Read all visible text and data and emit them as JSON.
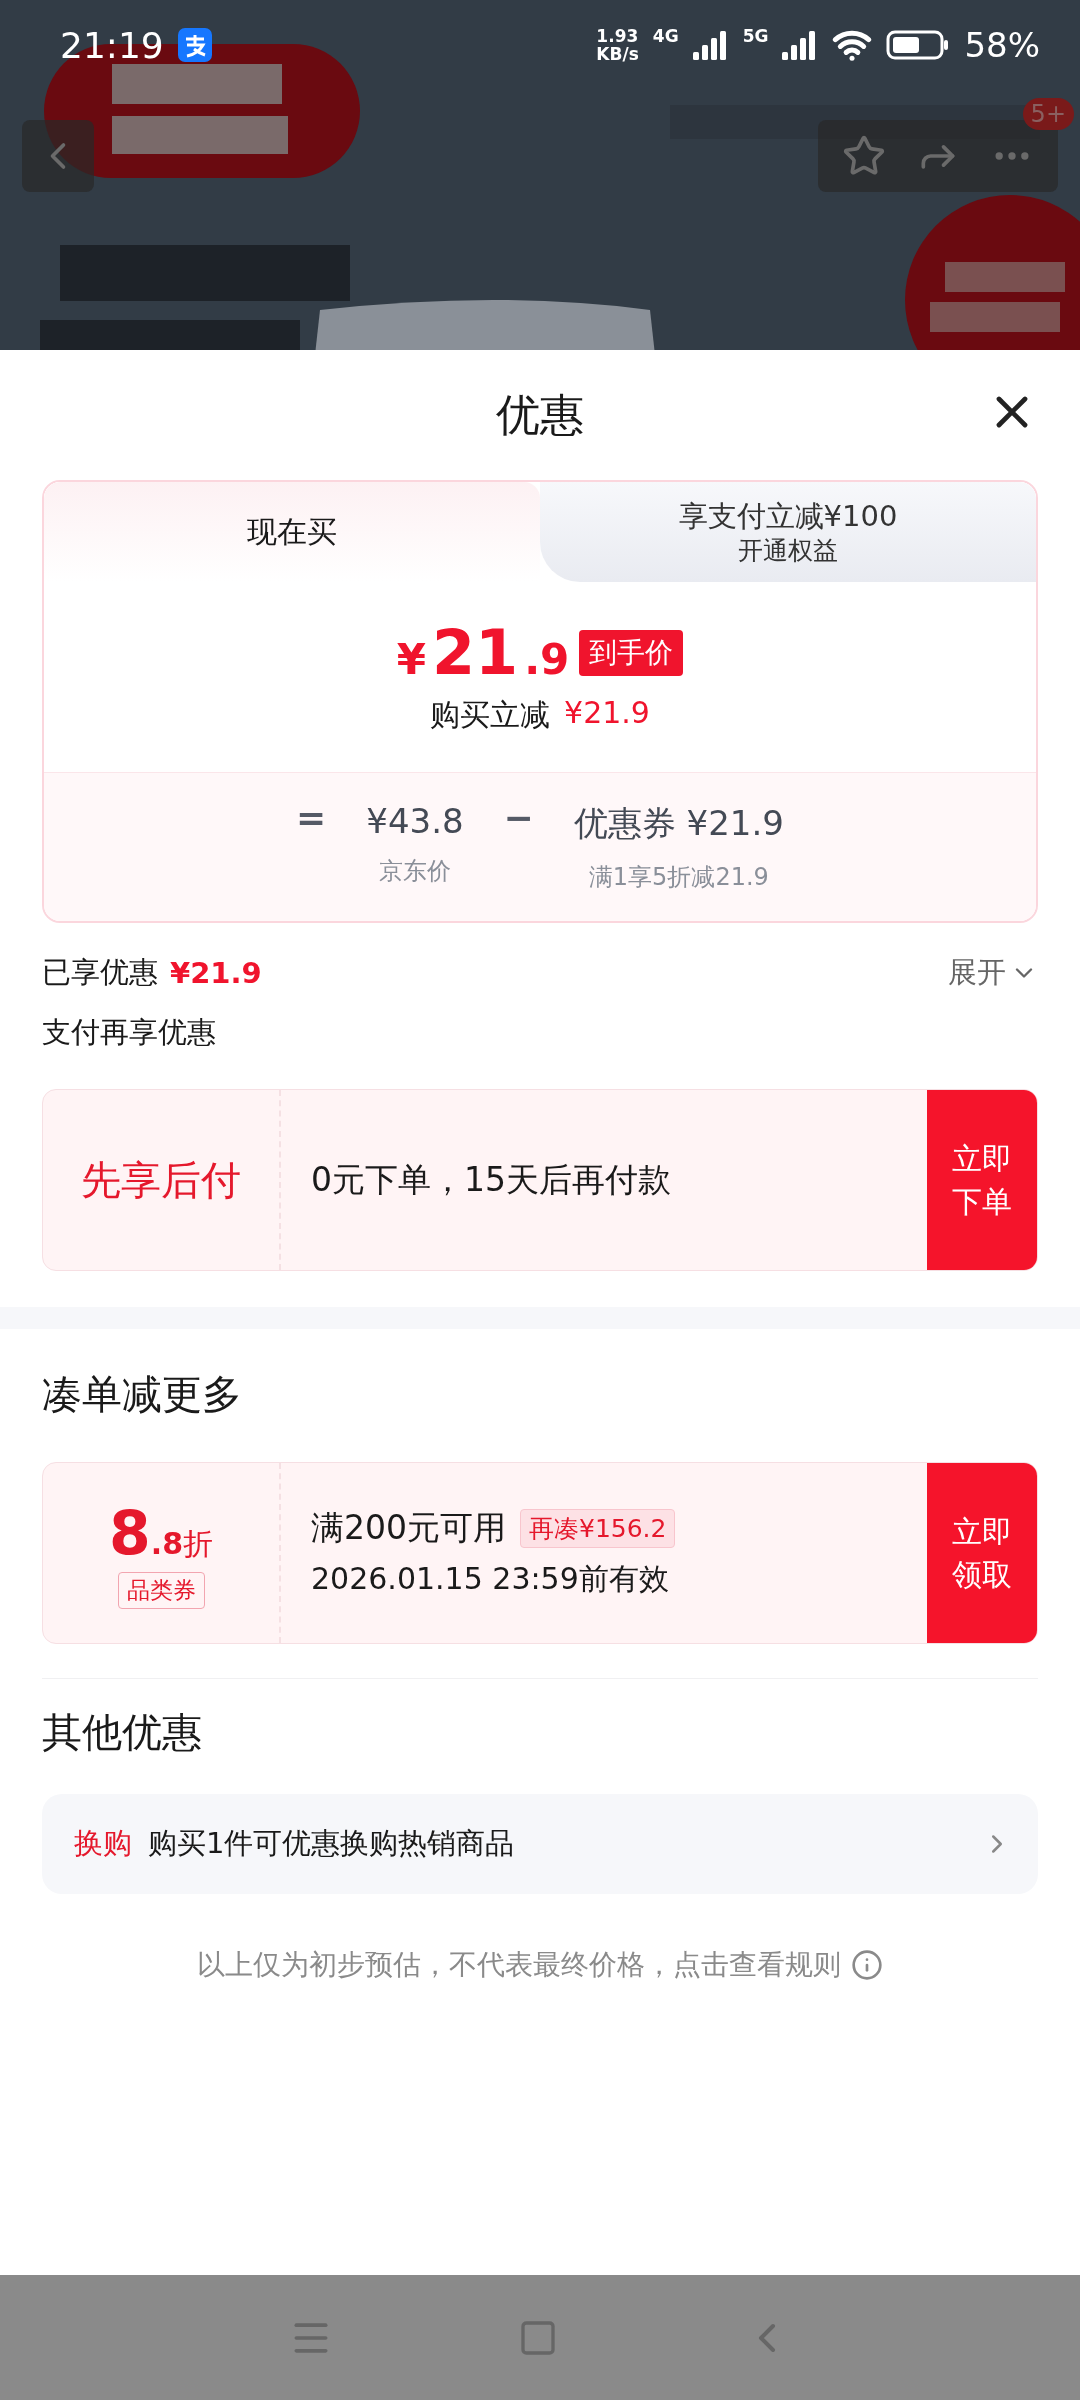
{
  "status_bar": {
    "time": "21:19",
    "speed_value": "1.93",
    "speed_unit": "KB/s",
    "networks": [
      "4G",
      "5G"
    ],
    "battery": "58%"
  },
  "top_nav": {
    "badge": "5+"
  },
  "sheet": {
    "title": "优惠"
  },
  "tabs": [
    {
      "label": "现在买",
      "selected": true
    },
    {
      "label": "享支付立减¥100",
      "sublabel": "开通权益",
      "selected": false
    }
  ],
  "price": {
    "symbol": "¥",
    "integer": "21",
    "decimal": ".9",
    "tag": "到手价",
    "reduce_label": "购买立减",
    "reduce_value": "¥21.9"
  },
  "formula": {
    "operators": [
      "=",
      "−"
    ],
    "terms": [
      {
        "value": "¥43.8",
        "caption": "京东价"
      },
      {
        "label": "优惠券",
        "value": "¥21.9",
        "caption": "满1享5折减21.9"
      }
    ]
  },
  "savings": {
    "label": "已享优惠",
    "value": "¥21.9",
    "toggle": "展开"
  },
  "pay_again": {
    "title": "支付再享优惠"
  },
  "pay_later": {
    "title": "先享后付",
    "text": "0元下单，15天后再付款",
    "button": "立即下单"
  },
  "bundle": {
    "title": "凑单减更多",
    "coupon": {
      "amount": "8",
      "decimal": ".8",
      "unit": "折",
      "type": "品类券",
      "condition": "满200元可用",
      "tag": "再凑¥156.2",
      "validity": "2026.01.15 23:59前有效",
      "button": "立即领取"
    }
  },
  "other": {
    "title": "其他优惠",
    "items": [
      {
        "tag": "换购",
        "text": "购买1件可优惠换购热销商品"
      }
    ]
  },
  "footer": {
    "text": "以上仅为初步预估，不代表最终价格，点击查看规则"
  }
}
